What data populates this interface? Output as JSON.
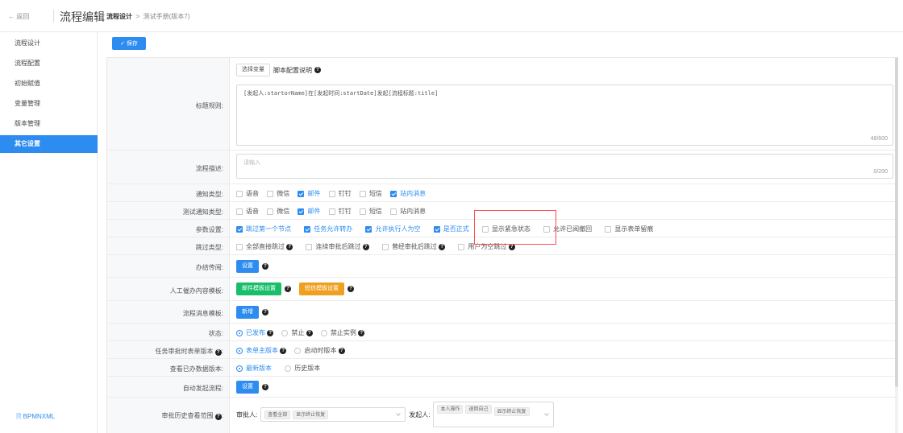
{
  "header": {
    "back_label": "← 返回",
    "app_title": "流程编辑",
    "breadcrumb_current": "流程设计",
    "breadcrumb_sep": ">",
    "breadcrumb_item": "测试手册(版本7)"
  },
  "sidebar": {
    "items": [
      {
        "label": "流程设计",
        "active": false
      },
      {
        "label": "流程配置",
        "active": false
      },
      {
        "label": "初始赋值",
        "active": false
      },
      {
        "label": "变量管理",
        "active": false
      },
      {
        "label": "版本管理",
        "active": false
      },
      {
        "label": "其它设置",
        "active": true
      }
    ],
    "footer_label": "BPMNXML"
  },
  "toolbar": {
    "save_label": "✓ 保存"
  },
  "form": {
    "title_rule": {
      "label": "标题规则:",
      "select_var_label": "选择变量",
      "script_help_label": "脚本配置说明",
      "value": "[发起人:startorName]在[发起时间:startDate]发起[流程标题:title]",
      "counter": "48/600"
    },
    "description": {
      "label": "流程描述:",
      "placeholder": "请输入",
      "counter": "0/200"
    },
    "notify_type": {
      "label": "通知类型:",
      "options": [
        {
          "label": "语音",
          "checked": false
        },
        {
          "label": "微信",
          "checked": false
        },
        {
          "label": "邮件",
          "checked": true
        },
        {
          "label": "钉钉",
          "checked": false
        },
        {
          "label": "短信",
          "checked": false
        },
        {
          "label": "站内消息",
          "checked": true
        }
      ]
    },
    "test_notify_type": {
      "label": "测试通知类型:",
      "options": [
        {
          "label": "语音",
          "checked": false
        },
        {
          "label": "微信",
          "checked": false
        },
        {
          "label": "邮件",
          "checked": true
        },
        {
          "label": "钉钉",
          "checked": false
        },
        {
          "label": "短信",
          "checked": false
        },
        {
          "label": "站内消息",
          "checked": false
        }
      ]
    },
    "params": {
      "label": "参数设置:",
      "options": [
        {
          "label": "跳过第一个节点",
          "checked": true
        },
        {
          "label": "任务允许转办",
          "checked": true
        },
        {
          "label": "允许执行人为空",
          "checked": true
        },
        {
          "label": "是否正式",
          "checked": true
        },
        {
          "label": "显示紧急状态",
          "checked": false
        },
        {
          "label": "允许已阅撤回",
          "checked": false
        },
        {
          "label": "显示表单留痕",
          "checked": false
        }
      ]
    },
    "skip_type": {
      "label": "跳过类型:",
      "options": [
        {
          "label": "全部直接跳过",
          "checked": false
        },
        {
          "label": "连续审批后跳过",
          "checked": false
        },
        {
          "label": "曾经审批后跳过",
          "checked": false
        },
        {
          "label": "用户为空跳过",
          "checked": false
        }
      ]
    },
    "circulate": {
      "label": "办结传阅:",
      "button": "设置"
    },
    "urge_template": {
      "label": "人工催办内容模板:",
      "mail_button": "邮件模板设置",
      "sms_button": "短信模板设置"
    },
    "message_template": {
      "label": "流程消息模板:",
      "button": "新增"
    },
    "status": {
      "label": "状态:",
      "options": [
        {
          "label": "已发布",
          "checked": true,
          "help": true
        },
        {
          "label": "禁止",
          "checked": false,
          "help": true
        },
        {
          "label": "禁止实例",
          "checked": false,
          "help": true
        }
      ]
    },
    "form_version": {
      "label": "任务审批时表单版本",
      "options": [
        {
          "label": "表单主版本",
          "checked": true,
          "help": true
        },
        {
          "label": "启动时版本",
          "checked": false,
          "help": true
        }
      ]
    },
    "done_data_version": {
      "label": "查看已办数据版本:",
      "options": [
        {
          "label": "最新版本",
          "checked": true
        },
        {
          "label": "历史版本",
          "checked": false
        }
      ]
    },
    "auto_start": {
      "label": "自动发起流程:",
      "button": "设置"
    },
    "history_scope": {
      "label": "审批历史查看范围",
      "approver_label": "审批人:",
      "approver_tags": [
        "查看全部",
        "显示终止恢复"
      ],
      "initiator_label": "发起人:",
      "initiator_tags": [
        "本人操作",
        "退回自己",
        "显示终止恢复"
      ]
    }
  },
  "colors": {
    "primary": "#2d8cf0",
    "green": "#19be6b",
    "orange": "#f0a020",
    "highlight": "#ff4d4f"
  }
}
